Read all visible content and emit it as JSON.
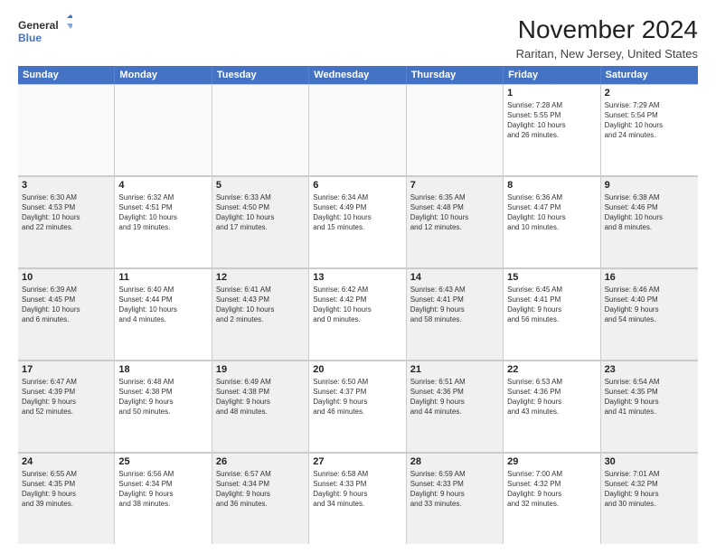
{
  "logo": {
    "line1": "General",
    "line2": "Blue"
  },
  "title": "November 2024",
  "subtitle": "Raritan, New Jersey, United States",
  "days": [
    "Sunday",
    "Monday",
    "Tuesday",
    "Wednesday",
    "Thursday",
    "Friday",
    "Saturday"
  ],
  "rows": [
    [
      {
        "day": "",
        "empty": true
      },
      {
        "day": "",
        "empty": true
      },
      {
        "day": "",
        "empty": true
      },
      {
        "day": "",
        "empty": true
      },
      {
        "day": "",
        "empty": true
      },
      {
        "day": "1",
        "lines": [
          "Sunrise: 7:28 AM",
          "Sunset: 5:55 PM",
          "Daylight: 10 hours",
          "and 26 minutes."
        ]
      },
      {
        "day": "2",
        "lines": [
          "Sunrise: 7:29 AM",
          "Sunset: 5:54 PM",
          "Daylight: 10 hours",
          "and 24 minutes."
        ]
      }
    ],
    [
      {
        "day": "3",
        "shaded": true,
        "lines": [
          "Sunrise: 6:30 AM",
          "Sunset: 4:53 PM",
          "Daylight: 10 hours",
          "and 22 minutes."
        ]
      },
      {
        "day": "4",
        "lines": [
          "Sunrise: 6:32 AM",
          "Sunset: 4:51 PM",
          "Daylight: 10 hours",
          "and 19 minutes."
        ]
      },
      {
        "day": "5",
        "shaded": true,
        "lines": [
          "Sunrise: 6:33 AM",
          "Sunset: 4:50 PM",
          "Daylight: 10 hours",
          "and 17 minutes."
        ]
      },
      {
        "day": "6",
        "lines": [
          "Sunrise: 6:34 AM",
          "Sunset: 4:49 PM",
          "Daylight: 10 hours",
          "and 15 minutes."
        ]
      },
      {
        "day": "7",
        "shaded": true,
        "lines": [
          "Sunrise: 6:35 AM",
          "Sunset: 4:48 PM",
          "Daylight: 10 hours",
          "and 12 minutes."
        ]
      },
      {
        "day": "8",
        "lines": [
          "Sunrise: 6:36 AM",
          "Sunset: 4:47 PM",
          "Daylight: 10 hours",
          "and 10 minutes."
        ]
      },
      {
        "day": "9",
        "shaded": true,
        "lines": [
          "Sunrise: 6:38 AM",
          "Sunset: 4:46 PM",
          "Daylight: 10 hours",
          "and 8 minutes."
        ]
      }
    ],
    [
      {
        "day": "10",
        "shaded": true,
        "lines": [
          "Sunrise: 6:39 AM",
          "Sunset: 4:45 PM",
          "Daylight: 10 hours",
          "and 6 minutes."
        ]
      },
      {
        "day": "11",
        "lines": [
          "Sunrise: 6:40 AM",
          "Sunset: 4:44 PM",
          "Daylight: 10 hours",
          "and 4 minutes."
        ]
      },
      {
        "day": "12",
        "shaded": true,
        "lines": [
          "Sunrise: 6:41 AM",
          "Sunset: 4:43 PM",
          "Daylight: 10 hours",
          "and 2 minutes."
        ]
      },
      {
        "day": "13",
        "lines": [
          "Sunrise: 6:42 AM",
          "Sunset: 4:42 PM",
          "Daylight: 10 hours",
          "and 0 minutes."
        ]
      },
      {
        "day": "14",
        "shaded": true,
        "lines": [
          "Sunrise: 6:43 AM",
          "Sunset: 4:41 PM",
          "Daylight: 9 hours",
          "and 58 minutes."
        ]
      },
      {
        "day": "15",
        "lines": [
          "Sunrise: 6:45 AM",
          "Sunset: 4:41 PM",
          "Daylight: 9 hours",
          "and 56 minutes."
        ]
      },
      {
        "day": "16",
        "shaded": true,
        "lines": [
          "Sunrise: 6:46 AM",
          "Sunset: 4:40 PM",
          "Daylight: 9 hours",
          "and 54 minutes."
        ]
      }
    ],
    [
      {
        "day": "17",
        "shaded": true,
        "lines": [
          "Sunrise: 6:47 AM",
          "Sunset: 4:39 PM",
          "Daylight: 9 hours",
          "and 52 minutes."
        ]
      },
      {
        "day": "18",
        "lines": [
          "Sunrise: 6:48 AM",
          "Sunset: 4:38 PM",
          "Daylight: 9 hours",
          "and 50 minutes."
        ]
      },
      {
        "day": "19",
        "shaded": true,
        "lines": [
          "Sunrise: 6:49 AM",
          "Sunset: 4:38 PM",
          "Daylight: 9 hours",
          "and 48 minutes."
        ]
      },
      {
        "day": "20",
        "lines": [
          "Sunrise: 6:50 AM",
          "Sunset: 4:37 PM",
          "Daylight: 9 hours",
          "and 46 minutes."
        ]
      },
      {
        "day": "21",
        "shaded": true,
        "lines": [
          "Sunrise: 6:51 AM",
          "Sunset: 4:36 PM",
          "Daylight: 9 hours",
          "and 44 minutes."
        ]
      },
      {
        "day": "22",
        "lines": [
          "Sunrise: 6:53 AM",
          "Sunset: 4:36 PM",
          "Daylight: 9 hours",
          "and 43 minutes."
        ]
      },
      {
        "day": "23",
        "shaded": true,
        "lines": [
          "Sunrise: 6:54 AM",
          "Sunset: 4:35 PM",
          "Daylight: 9 hours",
          "and 41 minutes."
        ]
      }
    ],
    [
      {
        "day": "24",
        "shaded": true,
        "lines": [
          "Sunrise: 6:55 AM",
          "Sunset: 4:35 PM",
          "Daylight: 9 hours",
          "and 39 minutes."
        ]
      },
      {
        "day": "25",
        "lines": [
          "Sunrise: 6:56 AM",
          "Sunset: 4:34 PM",
          "Daylight: 9 hours",
          "and 38 minutes."
        ]
      },
      {
        "day": "26",
        "shaded": true,
        "lines": [
          "Sunrise: 6:57 AM",
          "Sunset: 4:34 PM",
          "Daylight: 9 hours",
          "and 36 minutes."
        ]
      },
      {
        "day": "27",
        "lines": [
          "Sunrise: 6:58 AM",
          "Sunset: 4:33 PM",
          "Daylight: 9 hours",
          "and 34 minutes."
        ]
      },
      {
        "day": "28",
        "shaded": true,
        "lines": [
          "Sunrise: 6:59 AM",
          "Sunset: 4:33 PM",
          "Daylight: 9 hours",
          "and 33 minutes."
        ]
      },
      {
        "day": "29",
        "lines": [
          "Sunrise: 7:00 AM",
          "Sunset: 4:32 PM",
          "Daylight: 9 hours",
          "and 32 minutes."
        ]
      },
      {
        "day": "30",
        "shaded": true,
        "lines": [
          "Sunrise: 7:01 AM",
          "Sunset: 4:32 PM",
          "Daylight: 9 hours",
          "and 30 minutes."
        ]
      }
    ]
  ]
}
